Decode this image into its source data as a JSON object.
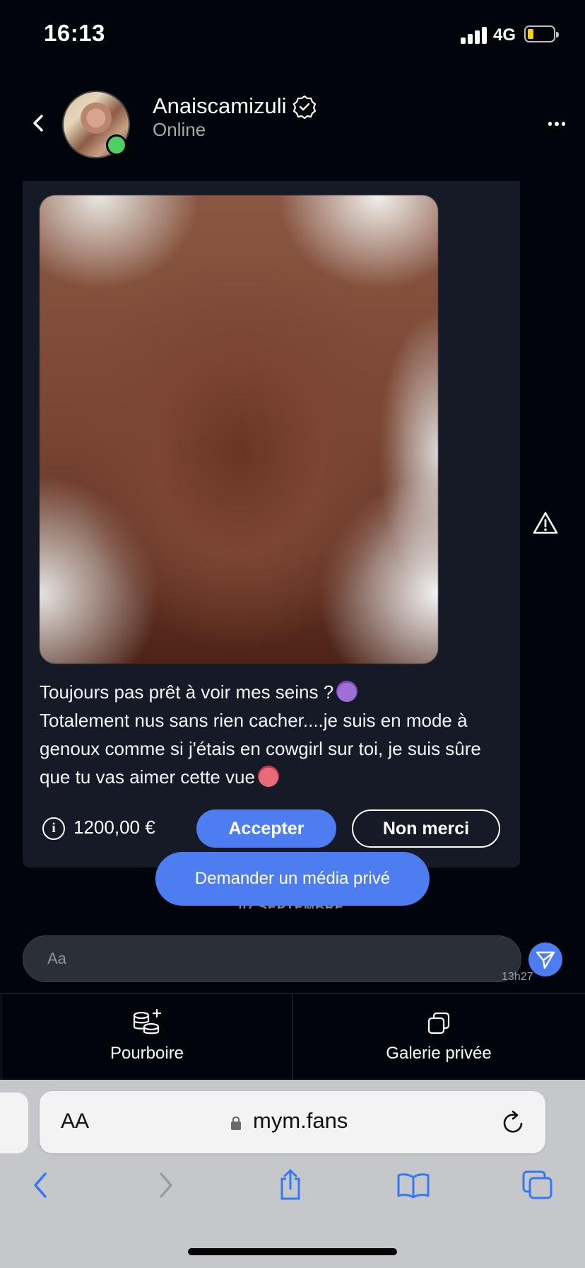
{
  "status_bar": {
    "time": "16:13",
    "network": "4G",
    "battery_color": "#f6d300"
  },
  "header": {
    "name": "Anaiscamizuli",
    "status": "Online",
    "icons": [
      "back-chevron-icon",
      "verified-badge-icon",
      "more-dots-icon"
    ]
  },
  "message": {
    "line1": "Toujours pas prêt à voir mes seins ?",
    "line2": "Totalement nus sans rien cacher....je suis en mode à genoux comme si j'étais en cowgirl sur toi, je suis sûre que tu vas aimer cette vue",
    "price": "1200,00 €",
    "accept_label": "Accepter",
    "decline_label": "Non merci"
  },
  "request_media_label": "Demander un média privé",
  "date_separator": "07 SEPTEMBRE",
  "composer": {
    "placeholder": "Aa",
    "last_time": "13h27"
  },
  "bottom_actions": {
    "tip_label": "Pourboire",
    "gallery_label": "Galerie privée"
  },
  "browser": {
    "aa_label": "AA",
    "url": "mym.fans"
  },
  "colors": {
    "accent": "#4d7df1",
    "online": "#4fcf61",
    "background": "#02040b",
    "card": "#151a26"
  }
}
